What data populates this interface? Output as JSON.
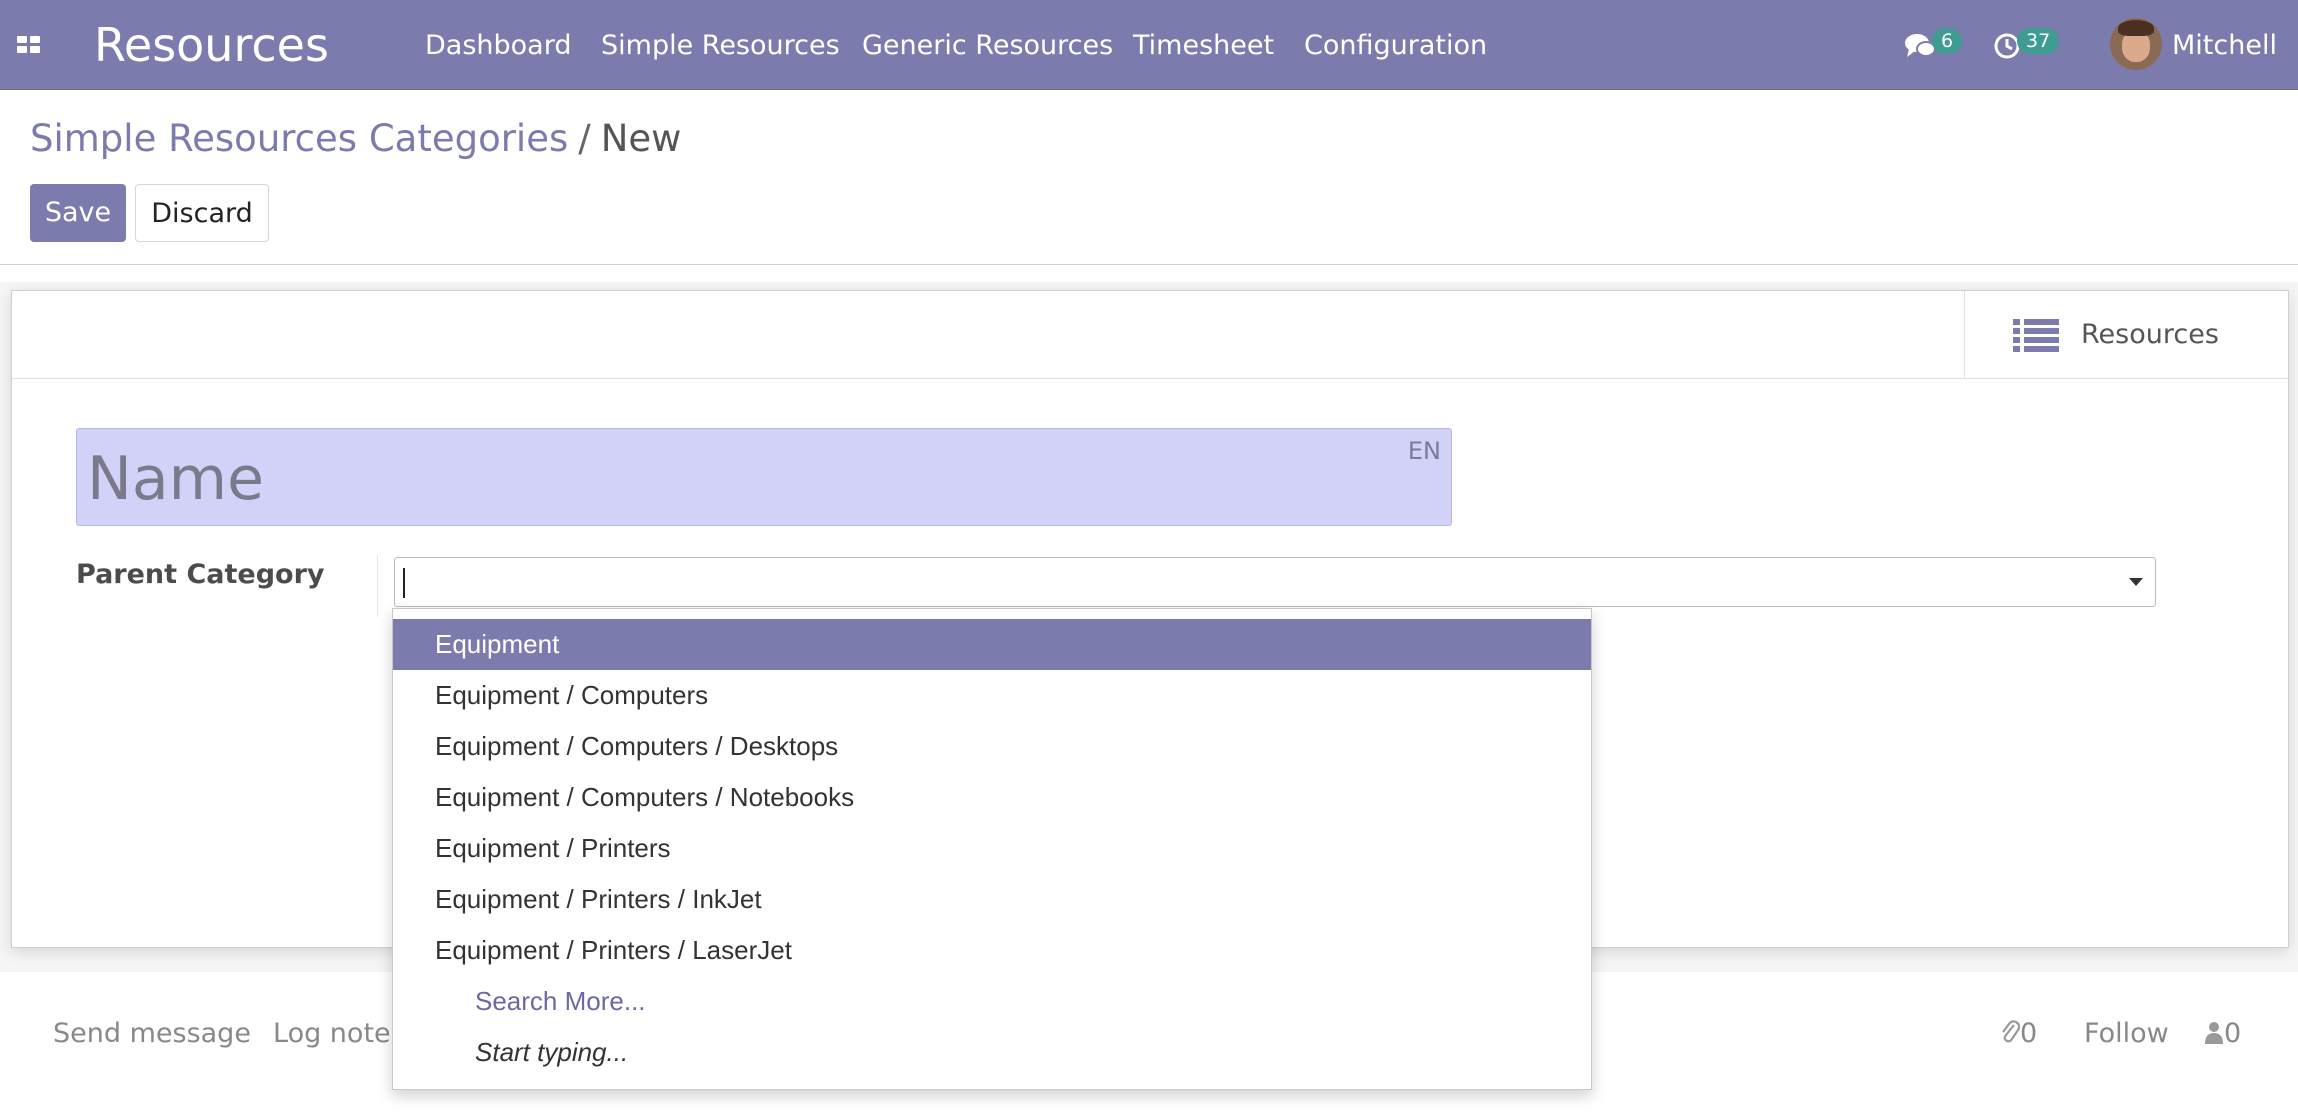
{
  "navbar": {
    "brand": "Resources",
    "menu": [
      {
        "label": "Dashboard"
      },
      {
        "label": "Simple Resources"
      },
      {
        "label": "Generic Resources"
      },
      {
        "label": "Timesheet"
      },
      {
        "label": "Configuration"
      }
    ],
    "messages_count": "6",
    "activities_count": "37",
    "user_name": "Mitchell",
    "icons": [
      "apps-grid-icon",
      "chat-bubbles-icon",
      "clock-icon",
      "avatar"
    ]
  },
  "breadcrumb": {
    "parent": "Simple Resources Categories",
    "separator": "/",
    "current": "New"
  },
  "actions": {
    "save_label": "Save",
    "discard_label": "Discard"
  },
  "smart_buttons": [
    {
      "label": "Resources",
      "icon": "list-icon"
    }
  ],
  "form": {
    "name_placeholder": "Name",
    "language": "EN",
    "parent_category_label": "Parent Category",
    "parent_category_value": ""
  },
  "autocomplete": {
    "items": [
      "Equipment",
      "Equipment / Computers",
      "Equipment / Computers / Desktops",
      "Equipment / Computers / Notebooks",
      "Equipment / Printers",
      "Equipment / Printers / InkJet",
      "Equipment / Printers / LaserJet"
    ],
    "search_more": "Search More...",
    "hint": "Start typing...",
    "active_index": 0
  },
  "chatter": {
    "send_message": "Send message",
    "log_note": "Log note",
    "attachments_count": "0",
    "follow": "Follow",
    "followers_count": "0"
  },
  "colors": {
    "brand": "#7c7bad",
    "badge": "#3e9c93",
    "required_field": "#d2d1f7"
  }
}
